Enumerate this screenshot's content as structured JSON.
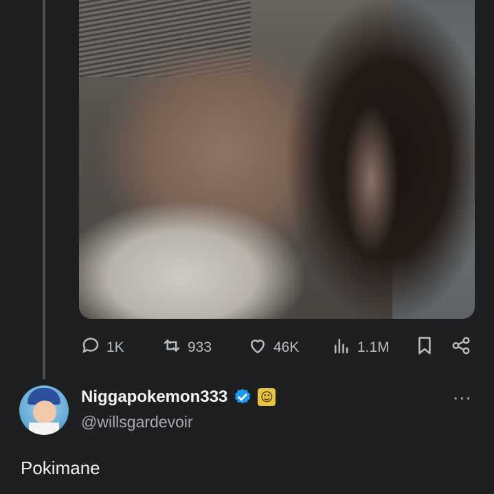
{
  "tweet": {
    "stats": {
      "replies": "1K",
      "reposts": "933",
      "likes": "46K",
      "views": "1.1M"
    },
    "icons": {
      "reply": "reply-icon",
      "repost": "repost-icon",
      "like": "heart-icon",
      "views": "views-icon",
      "bookmark": "bookmark-icon",
      "share": "share-icon"
    }
  },
  "reply": {
    "display_name": "Niggapokemon333",
    "handle": "@willsgardevoir",
    "badge_emoji": "☺",
    "more": "···",
    "text": "Pokimane"
  },
  "colors": {
    "background": "#1e1f20",
    "icon": "#b9bcbf",
    "verified": "#1d9bf0"
  }
}
